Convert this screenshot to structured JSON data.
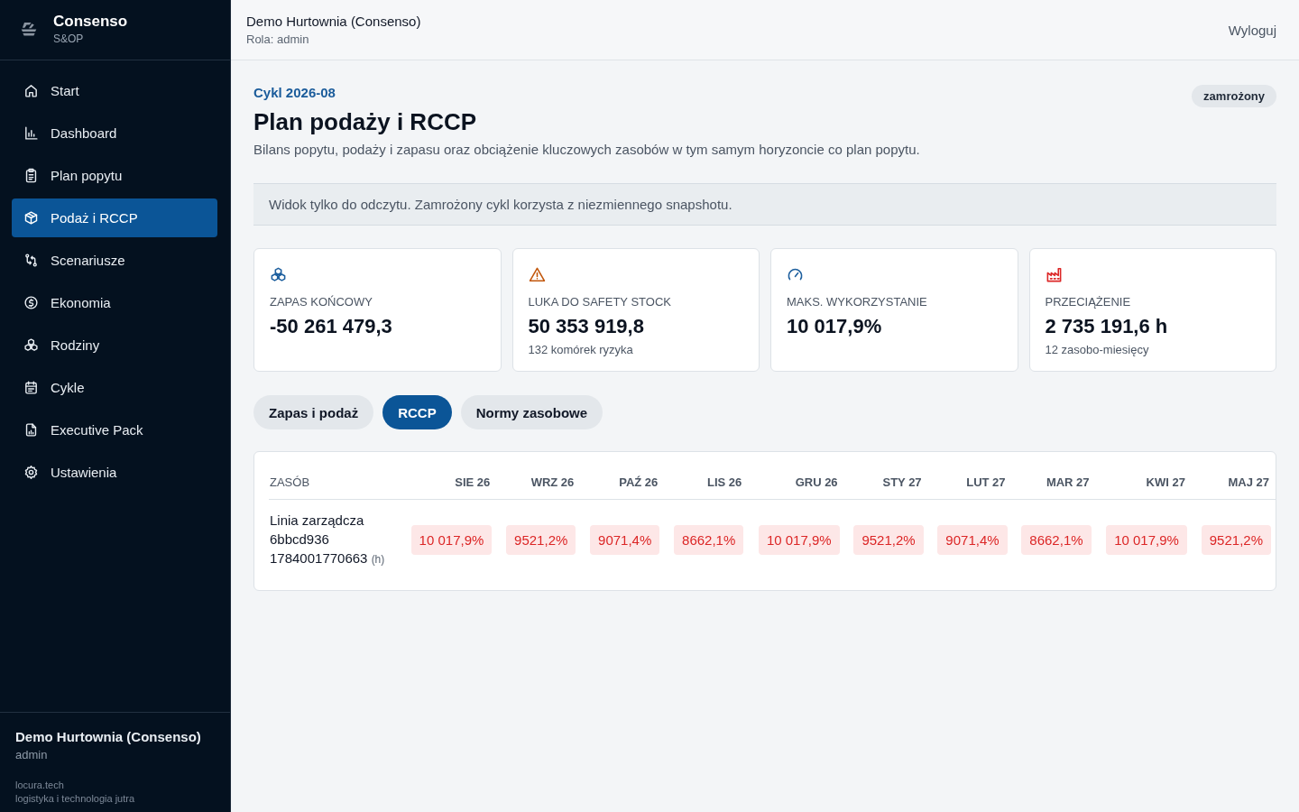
{
  "sidebar": {
    "brand": {
      "name": "Consenso",
      "subtitle": "S&OP"
    },
    "items": [
      {
        "label": "Start",
        "selected": false
      },
      {
        "label": "Dashboard",
        "selected": false
      },
      {
        "label": "Plan popytu",
        "selected": false
      },
      {
        "label": "Podaż i RCCP",
        "selected": true
      },
      {
        "label": "Scenariusze",
        "selected": false
      },
      {
        "label": "Ekonomia",
        "selected": false
      },
      {
        "label": "Rodziny",
        "selected": false
      },
      {
        "label": "Cykle",
        "selected": false
      },
      {
        "label": "Executive Pack",
        "selected": false
      },
      {
        "label": "Ustawienia",
        "selected": false
      }
    ],
    "footer": {
      "org": "Demo Hurtownia (Consenso)",
      "role": "admin",
      "company": "locura.tech",
      "tagline": "logistyka i technologia jutra"
    }
  },
  "header": {
    "org": "Demo Hurtownia (Consenso)",
    "role": "Rola: admin",
    "logout": "Wyloguj"
  },
  "page": {
    "cycle": "Cykl 2026-08",
    "status_badge": "zamrożony",
    "title": "Plan podaży i RCCP",
    "description": "Bilans popytu, podaży i zapasu oraz obciążenie kluczowych zasobów w tym samym horyzoncie co plan popytu.",
    "notice": "Widok tylko do odczytu. Zamrożony cykl korzysta z niezmiennego snapshotu."
  },
  "kpis": [
    {
      "label": "ZAPAS KOŃCOWY",
      "value": "-50 261 479,3",
      "color": "#1d5f9e"
    },
    {
      "label": "LUKA DO SAFETY STOCK",
      "value": "50 353 919,8",
      "note": "132 komórek ryzyka",
      "color": "#c2570c"
    },
    {
      "label": "MAKS. WYKORZYSTANIE",
      "value": "10 017,9%",
      "color": "#1d5f9e"
    },
    {
      "label": "PRZECIĄŻENIE",
      "value": "2 735 191,6 h",
      "note": "12 zasobo-miesięcy",
      "color": "#dc2626"
    }
  ],
  "tabs": [
    {
      "label": "Zapas i podaż",
      "selected": false
    },
    {
      "label": "RCCP",
      "selected": true
    },
    {
      "label": "Normy zasobowe",
      "selected": false
    }
  ],
  "table": {
    "columns": [
      "ZASÓB",
      "SIE 26",
      "WRZ 26",
      "PAŹ 26",
      "LIS 26",
      "GRU 26",
      "STY 27",
      "LUT 27",
      "MAR 27",
      "KWI 27",
      "MAJ 27"
    ],
    "rows": [
      {
        "cells": [
          {
            "kind": "resource",
            "value": "Linia zarządcza 6bbcd936 1784001770663",
            "unit": "(h)"
          },
          {
            "kind": "load",
            "value": "10 017,9%",
            "overloaded": true
          },
          {
            "kind": "load",
            "value": "9521,2%",
            "overloaded": true
          },
          {
            "kind": "load",
            "value": "9071,4%",
            "overloaded": true
          },
          {
            "kind": "load",
            "value": "8662,1%",
            "overloaded": true
          },
          {
            "kind": "load",
            "value": "10 017,9%",
            "overloaded": true
          },
          {
            "kind": "load",
            "value": "9521,2%",
            "overloaded": true
          },
          {
            "kind": "load",
            "value": "9071,4%",
            "overloaded": true
          },
          {
            "kind": "load",
            "value": "8662,1%",
            "overloaded": true
          },
          {
            "kind": "load",
            "value": "10 017,9%",
            "overloaded": true
          },
          {
            "kind": "load",
            "value": "9521,2%",
            "overloaded": true
          }
        ]
      }
    ]
  }
}
